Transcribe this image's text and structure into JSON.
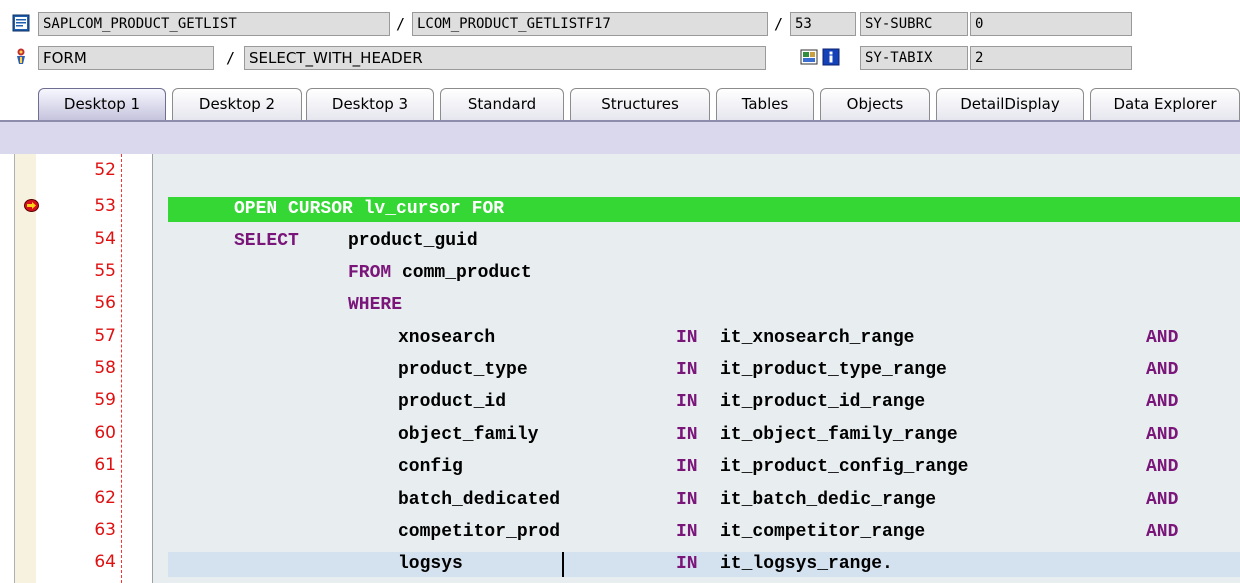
{
  "header": {
    "row1": {
      "program": "SAPLCOM_PRODUCT_GETLIST",
      "include": "LCOM_PRODUCT_GETLISTF17",
      "line": "53",
      "sysvar_name": "SY-SUBRC",
      "sysvar_value": "0",
      "icon": "source-program-icon"
    },
    "row2": {
      "event_type": "FORM",
      "event_name": "SELECT_WITH_HEADER",
      "sysvar_name": "SY-TABIX",
      "sysvar_value": "2",
      "icon": "event-icon",
      "display_icon": "display-object-icon",
      "info_icon": "info-icon"
    },
    "separator": "/"
  },
  "tabs": [
    {
      "label": "Desktop 1",
      "active": true
    },
    {
      "label": "Desktop 2",
      "active": false
    },
    {
      "label": "Desktop 3",
      "active": false
    },
    {
      "label": "Standard",
      "active": false
    },
    {
      "label": "Structures",
      "active": false
    },
    {
      "label": "Tables",
      "active": false
    },
    {
      "label": "Objects",
      "active": false
    },
    {
      "label": "DetailDisplay",
      "active": false
    },
    {
      "label": "Data Explorer",
      "active": false
    }
  ],
  "editor": {
    "breakpoint_line": "53",
    "current_line": "53",
    "lines": [
      {
        "num": "52",
        "segments": []
      },
      {
        "num": "53",
        "segments": [
          "OPEN CURSOR lv_cursor FOR"
        ]
      },
      {
        "num": "54",
        "segments": [
          "SELECT",
          "product_guid"
        ]
      },
      {
        "num": "55",
        "segments": [
          "FROM",
          "comm_product"
        ]
      },
      {
        "num": "56",
        "segments": [
          "WHERE"
        ]
      },
      {
        "num": "57",
        "segments": [
          "xnosearch",
          "IN",
          "it_xnosearch_range",
          "AND"
        ]
      },
      {
        "num": "58",
        "segments": [
          "product_type",
          "IN",
          "it_product_type_range",
          "AND"
        ]
      },
      {
        "num": "59",
        "segments": [
          "product_id",
          "IN",
          "it_product_id_range",
          "AND"
        ]
      },
      {
        "num": "60",
        "segments": [
          "object_family",
          "IN",
          "it_object_family_range",
          "AND"
        ]
      },
      {
        "num": "61",
        "segments": [
          "config",
          "IN",
          "it_product_config_range",
          "AND"
        ]
      },
      {
        "num": "62",
        "segments": [
          "batch_dedicated",
          "IN",
          "it_batch_dedic_range",
          "AND"
        ]
      },
      {
        "num": "63",
        "segments": [
          "competitor_prod",
          "IN",
          "it_competitor_range",
          "AND"
        ]
      },
      {
        "num": "64",
        "segments": [
          "logsys",
          "IN",
          "it_logsys_range."
        ]
      }
    ]
  },
  "colors": {
    "execution_line": "#35d735",
    "cursor_line": "#d4e1ee",
    "keyword": "#7a167a",
    "line_number": "#e01010"
  }
}
